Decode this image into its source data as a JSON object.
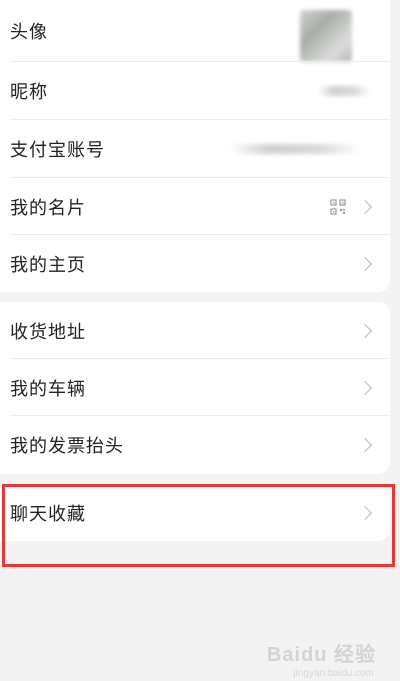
{
  "profile_section": {
    "rows": [
      {
        "label": "头像"
      },
      {
        "label": "昵称"
      },
      {
        "label": "支付宝账号"
      },
      {
        "label": "我的名片"
      },
      {
        "label": "我的主页"
      }
    ]
  },
  "address_section": {
    "rows": [
      {
        "label": "收货地址"
      },
      {
        "label": "我的车辆"
      },
      {
        "label": "我的发票抬头"
      }
    ]
  },
  "favorites_section": {
    "rows": [
      {
        "label": "聊天收藏"
      }
    ]
  },
  "annotation": {
    "highlight_color": "#e53935"
  },
  "watermark": {
    "text": "Baidu 经验",
    "sub": "jingyan.baidu.com"
  }
}
